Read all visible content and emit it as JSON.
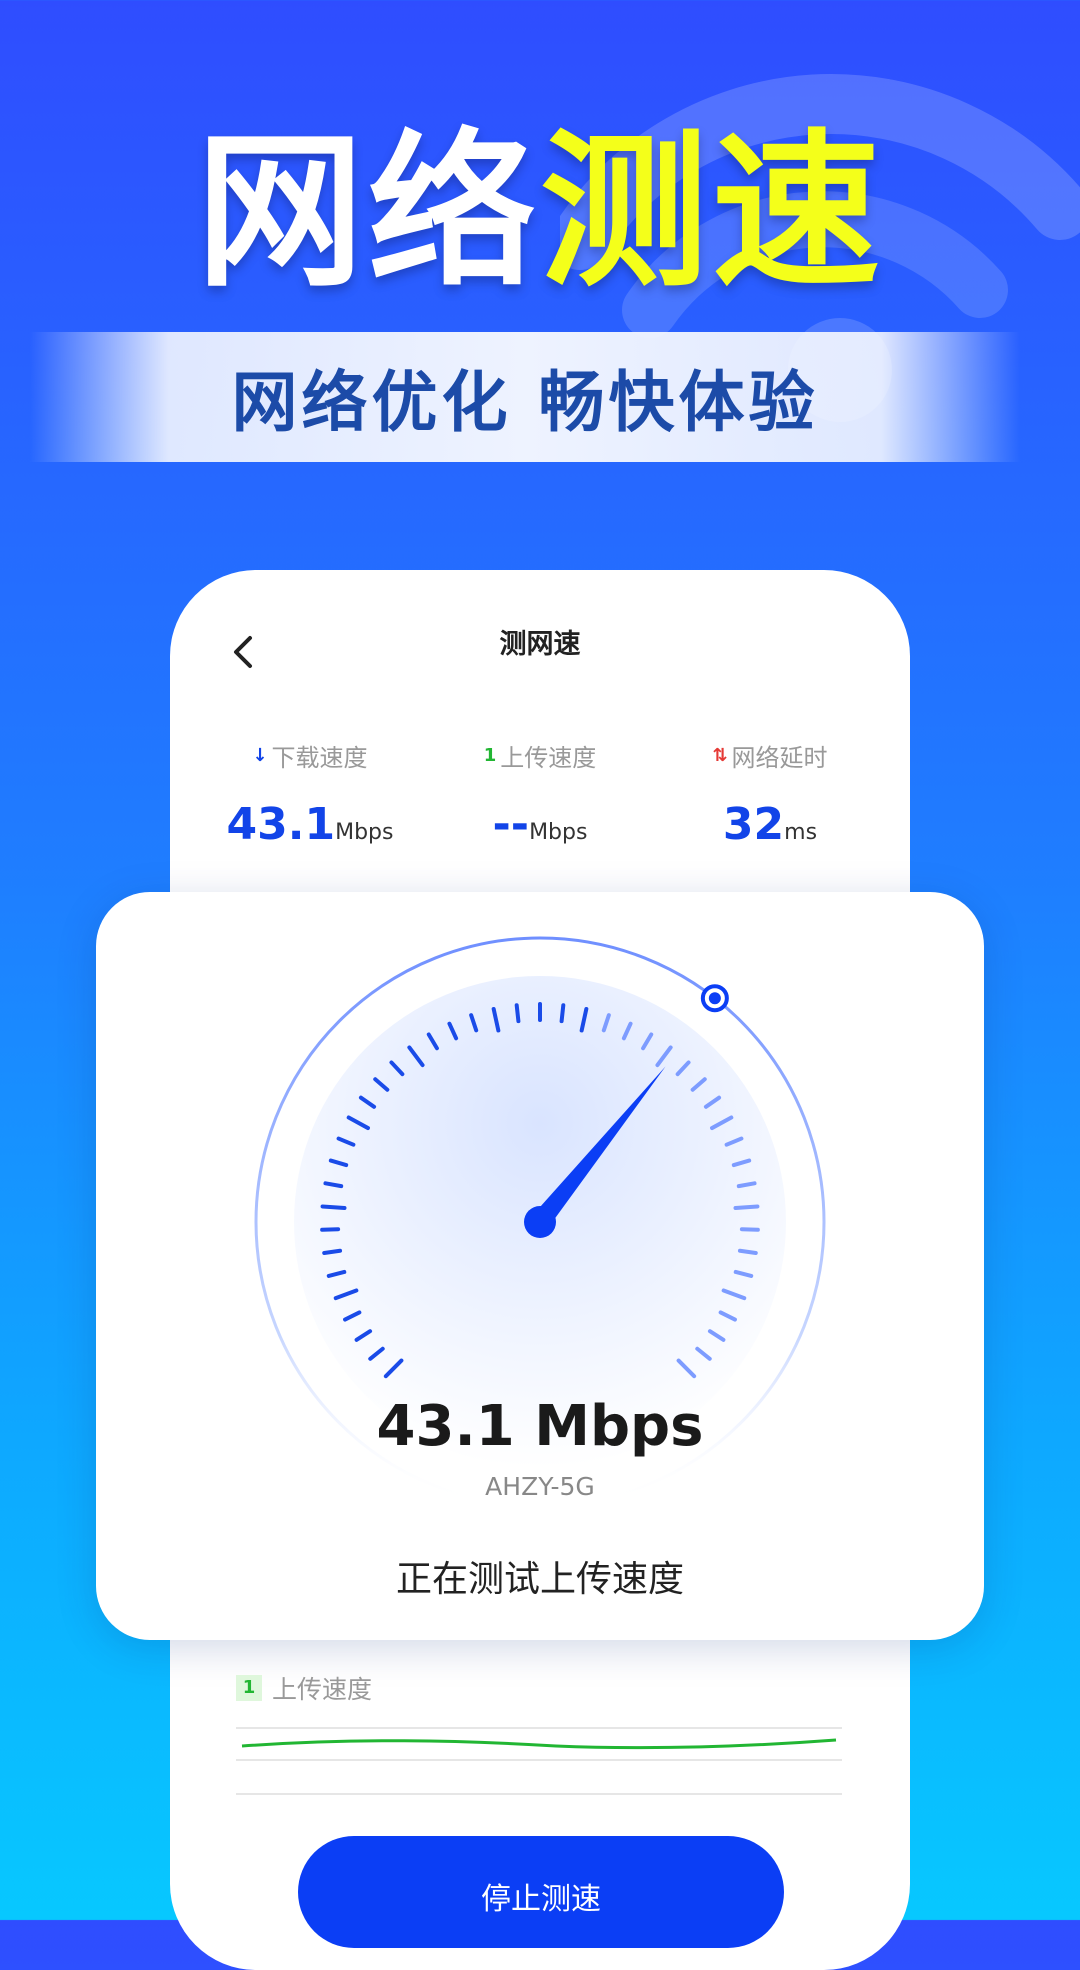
{
  "headline": {
    "part1": "网络",
    "part2": "测速"
  },
  "subtitle": "网络优化 畅快体验",
  "screen": {
    "title": "测网速",
    "stats": [
      {
        "label": "下载速度",
        "arrow": "↓",
        "value": "43.1",
        "unit": "Mbps",
        "color": "#1244e8"
      },
      {
        "label": "上传速度",
        "arrow": "1",
        "value": "--",
        "unit": "Mbps",
        "color": "#22b633"
      },
      {
        "label": "网络延时",
        "arrow": "⇅",
        "value": "32",
        "unit": "ms",
        "color": "#e53935"
      }
    ],
    "gauge": {
      "speed": "43.1 Mbps",
      "ssid": "AHZY-5G",
      "status": "正在测试上传速度",
      "progress": 0.36
    },
    "upload": {
      "label": "上传速度",
      "badge": "1"
    },
    "stop_button": "停止测速"
  },
  "colors": {
    "accent": "#0b3ef5",
    "headline_highlight": "#f4ff1a",
    "upload_line": "#22b633"
  }
}
